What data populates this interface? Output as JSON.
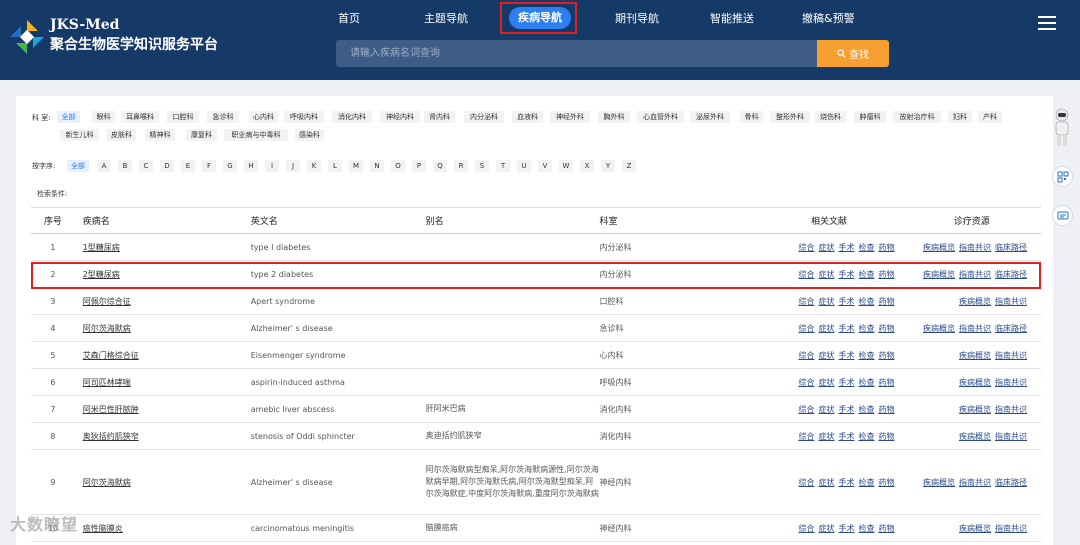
{
  "brand": {
    "name_en": "JKS-Med",
    "name_cn": "聚合生物医学知识服务平台"
  },
  "nav": {
    "items": [
      "首页",
      "主题导航",
      "疾病导航",
      "期刊导航",
      "智能推送",
      "撤稿&预警"
    ],
    "active": "疾病导航"
  },
  "search": {
    "placeholder": "请输入疾病名词查询",
    "button": "查找"
  },
  "filters": {
    "dept_label": "科 室:",
    "depts": [
      "全部",
      "眼科",
      "耳鼻喉科",
      "口腔科",
      "急诊科",
      "心内科",
      "呼吸内科",
      "消化内科",
      "神经内科",
      "肾内科",
      "内分泌科",
      "血液科",
      "神经外科",
      "胸外科",
      "心血管外科",
      "泌尿外科",
      "骨科",
      "整形外科",
      "烧伤科",
      "肿瘤科",
      "放射治疗科",
      "妇科",
      "产科",
      "新生儿科",
      "皮肤科",
      "精神科",
      "康复科",
      "职业病与中毒科",
      "感染科"
    ],
    "letter_label": "按字序:",
    "letters": [
      "全部",
      "A",
      "B",
      "C",
      "D",
      "E",
      "F",
      "G",
      "H",
      "I",
      "J",
      "K",
      "L",
      "M",
      "N",
      "O",
      "P",
      "Q",
      "R",
      "S",
      "T",
      "U",
      "V",
      "W",
      "X",
      "Y",
      "Z"
    ],
    "condition_label": "检索条件:"
  },
  "table": {
    "headers": {
      "idx": "序号",
      "name": "疾病名",
      "en": "英文名",
      "alias": "别名",
      "dept": "科室",
      "lit": "相关文献",
      "res": "诊疗资源"
    },
    "lit_links": [
      "综合",
      "症状",
      "手术",
      "检查",
      "药物"
    ],
    "rows": [
      {
        "idx": "1",
        "name": "1型糖尿病",
        "en": "type Ⅰ diabetes",
        "alias": "",
        "dept": "内分泌科",
        "res": [
          "疾病概览",
          "指南共识",
          "临床路径"
        ]
      },
      {
        "idx": "2",
        "name": "2型糖尿病",
        "en": "type 2 diabetes",
        "alias": "",
        "dept": "内分泌科",
        "res": [
          "疾病概览",
          "指南共识",
          "临床路径"
        ]
      },
      {
        "idx": "3",
        "name": "阿佩尔综合征",
        "en": "Apert syndrome",
        "alias": "",
        "dept": "口腔科",
        "res": [
          "疾病概览",
          "指南共识"
        ]
      },
      {
        "idx": "4",
        "name": "阿尔茨海默病",
        "en": "Alzheimer' s disease",
        "alias": "",
        "dept": "急诊科",
        "res": [
          "疾病概览",
          "指南共识",
          "临床路径"
        ]
      },
      {
        "idx": "5",
        "name": "艾森门格综合征",
        "en": "Eisenmenger syndrome",
        "alias": "",
        "dept": "心内科",
        "res": [
          "疾病概览",
          "指南共识"
        ]
      },
      {
        "idx": "6",
        "name": "阿司匹林哮喘",
        "en": "aspirin-induced asthma",
        "alias": "",
        "dept": "呼吸内科",
        "res": [
          "疾病概览",
          "指南共识"
        ]
      },
      {
        "idx": "7",
        "name": "阿米巴性肝脓肿",
        "en": "amebic liver abscess",
        "alias": "肝阿米巴病",
        "dept": "消化内科",
        "res": [
          "疾病概览",
          "指南共识"
        ]
      },
      {
        "idx": "8",
        "name": "奥狄括约肌狭窄",
        "en": "stenosis of Oddi sphincter",
        "alias": "奥迪括约肌狭窄",
        "dept": "消化内科",
        "res": [
          "疾病概览",
          "指南共识"
        ]
      },
      {
        "idx": "9",
        "name": "阿尔茨海默病",
        "en": "Alzheimer' s disease",
        "alias": "阿尔茨海默病型痴呆,阿尔茨海默病源性,阿尔茨海默病早期,阿尔茨海默氏病,阿尔茨海默型痴呆,阿尔茨海默症,中度阿尔茨海默病,重度阿尔茨海默病",
        "dept": "神经内科",
        "res": [
          "疾病概览",
          "指南共识",
          "临床路径"
        ]
      },
      {
        "idx": "10",
        "name": "癌性脑膜炎",
        "en": "carcinomatous meningitis",
        "alias": "脑膜癌病",
        "dept": "神经内科",
        "res": [
          "疾病概览",
          "指南共识"
        ]
      }
    ]
  },
  "watermark": "大数瞭望"
}
